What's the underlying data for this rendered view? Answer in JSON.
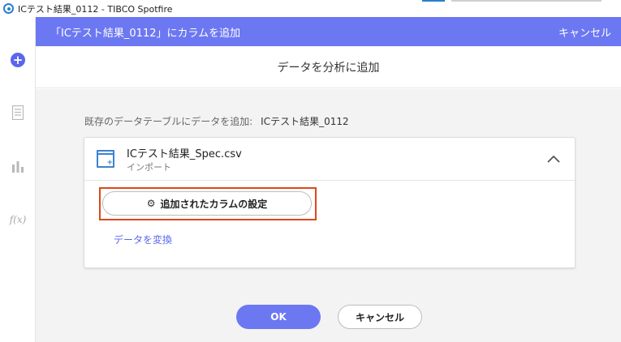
{
  "window": {
    "title": "ICテスト結果_0112 - TIBCO Spotfire"
  },
  "sidebar": {
    "items": [
      {
        "icon": "add-circle-icon"
      },
      {
        "icon": "data-table-icon"
      },
      {
        "icon": "bar-chart-icon"
      },
      {
        "icon": "function-icon",
        "label": "f(x)"
      }
    ]
  },
  "header": {
    "title": "「ICテスト結果_0112」にカラムを追加",
    "cancel_label": "キャンセル"
  },
  "subheader": {
    "title": "データを分析に追加"
  },
  "main": {
    "existing_label": "既存のデータテーブルにデータを追加:",
    "table_name": "ICテスト結果_0112",
    "source": {
      "file_name": "ICテスト結果_Spec.csv",
      "sub_label": "インポート",
      "expanded": true
    },
    "settings_button_label": "追加されたカラムの設定",
    "transform_link_label": "データを変換"
  },
  "footer": {
    "ok_label": "OK",
    "cancel_label": "キャンセル"
  },
  "colors": {
    "accent": "#6c78f2",
    "highlight": "#e0461a"
  }
}
